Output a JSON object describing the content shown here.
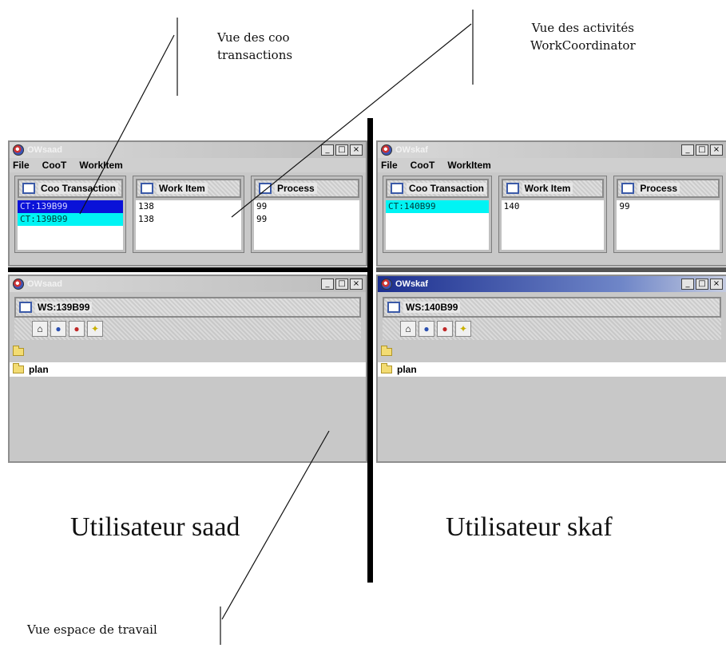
{
  "annotations": {
    "coo_view_label": [
      "Vue des coo",
      "transactions"
    ],
    "activities_view_label": [
      "Vue des activités",
      "WorkCoordinator"
    ],
    "workspace_view_label": "Vue espace de travail"
  },
  "users": {
    "left_label": "Utilisateur saad",
    "right_label": "Utilisateur skaf"
  },
  "left": {
    "top_window": {
      "title": "OWsaad",
      "menu": [
        "File",
        "CooT",
        "WorkItem"
      ],
      "coo_tab": "Coo Transaction",
      "coo_rows": [
        "CT:139B99",
        "CT:139B99"
      ],
      "work_tab": "Work Item",
      "work_rows": [
        "138",
        "138"
      ],
      "process_tab": "Process",
      "process_rows": [
        "99",
        "99"
      ]
    },
    "bottom_window": {
      "title": "OWsaad",
      "ws_tab": "WS:139B99",
      "folder": "plan"
    }
  },
  "right": {
    "top_window": {
      "title": "OWskaf",
      "menu": [
        "File",
        "CooT",
        "WorkItem"
      ],
      "coo_tab": "Coo Transaction",
      "coo_rows": [
        "CT:140B99"
      ],
      "work_tab": "Work Item",
      "work_rows": [
        "140"
      ],
      "process_tab": "Process",
      "process_rows": [
        "99"
      ]
    },
    "bottom_window": {
      "title": "OWskaf",
      "ws_tab": "WS:140B99",
      "folder": "plan"
    }
  },
  "window_controls": {
    "minimize": "_",
    "maximize": "□",
    "close": "×"
  },
  "icons": [
    "app-icon",
    "panel-icon",
    "home-icon",
    "user-blue-icon",
    "user-red-icon",
    "star-icon",
    "folder-icon"
  ],
  "colors": {
    "selection_dark": "#0a12d8",
    "selection_cyan": "#00f4f4",
    "active_title": "#1c2f8f"
  }
}
